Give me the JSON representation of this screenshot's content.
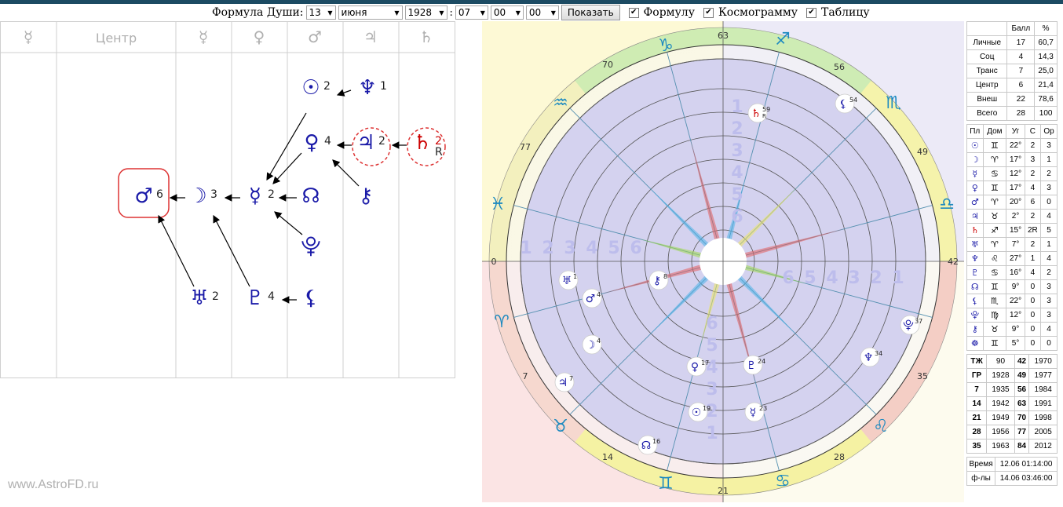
{
  "form": {
    "label": "Формула Души:",
    "day": "13",
    "month": "июня",
    "year": "1928",
    "hour": "07",
    "minute": "00",
    "second": "00",
    "separator": ":",
    "button": "Показать",
    "opt1": "Формулу",
    "opt2": "Космограмму",
    "opt3": "Таблицу",
    "check": "✔"
  },
  "grid_headers": [
    "☿",
    "Центр",
    "☿",
    "♀",
    "♂",
    "♃",
    "♄"
  ],
  "formula_nodes": [
    {
      "glyph": "☉",
      "num": "2",
      "color": "#1a1aa8"
    },
    {
      "glyph": "♆",
      "num": "1",
      "color": "#1a1aa8"
    },
    {
      "glyph": "♀",
      "num": "4",
      "color": "#1a1aa8"
    },
    {
      "glyph": "♃",
      "num": "2",
      "color": "#1a1aa8"
    },
    {
      "glyph": "♄",
      "num": "2",
      "sub": "R",
      "color": "#c00"
    },
    {
      "glyph": "♂",
      "num": "6",
      "color": "#1a1aa8"
    },
    {
      "glyph": "☽",
      "num": "3",
      "color": "#1a1aa8"
    },
    {
      "glyph": "☿",
      "num": "2",
      "color": "#1a1aa8"
    },
    {
      "glyph": "☊",
      "num": "",
      "color": "#1a1aa8"
    },
    {
      "glyph": "⚷",
      "num": "",
      "color": "#1a1aa8"
    },
    {
      "glyph": "⯓",
      "num": "",
      "color": "#1a1aa8"
    },
    {
      "glyph": "♅",
      "num": "2",
      "color": "#1a1aa8"
    },
    {
      "glyph": "♇",
      "num": "4",
      "color": "#1a1aa8"
    },
    {
      "glyph": "⚸",
      "num": "",
      "color": "#1a1aa8"
    }
  ],
  "footer": "www.AstroFD.ru",
  "chart": {
    "degree_labels": [
      "63",
      "56",
      "49",
      "42",
      "35",
      "28",
      "21",
      "14",
      "7",
      "0",
      "77",
      "70"
    ],
    "zodiac": [
      "♐",
      "♏",
      "♎",
      "♌",
      "♋",
      "♊",
      "♉",
      "♈",
      "♓",
      "♒",
      "♑"
    ],
    "ring_numbers_top": [
      "1",
      "2",
      "3",
      "4",
      "5",
      "6"
    ],
    "ring_numbers_left": [
      "1",
      "2",
      "3",
      "4",
      "5",
      "6"
    ],
    "ring_numbers_right": [
      "6",
      "5",
      "4",
      "3",
      "2",
      "1"
    ],
    "ring_numbers_bottom": [
      "6",
      "5",
      "4",
      "3",
      "2",
      "1"
    ],
    "planets": [
      {
        "glyph": "♄",
        "deg": "59",
        "sub": "R"
      },
      {
        "glyph": "⚸",
        "deg": "54"
      },
      {
        "glyph": "♅",
        "deg": "1"
      },
      {
        "glyph": "♂",
        "deg": "4"
      },
      {
        "glyph": "☽",
        "deg": "4"
      },
      {
        "glyph": "♃",
        "deg": "7"
      },
      {
        "glyph": "⚷",
        "deg": "8"
      },
      {
        "glyph": "♀",
        "deg": "17"
      },
      {
        "glyph": "♇",
        "deg": "24"
      },
      {
        "glyph": "☉",
        "deg": "19"
      },
      {
        "glyph": "☿",
        "deg": "23"
      },
      {
        "glyph": "☊",
        "deg": "16"
      },
      {
        "glyph": "♆",
        "deg": "34"
      },
      {
        "glyph": "⯓",
        "deg": "37"
      }
    ]
  },
  "score_table": {
    "headers": [
      "",
      "Балл",
      "%"
    ],
    "rows": [
      [
        "Личные",
        "17",
        "60,7"
      ],
      [
        "Соц",
        "4",
        "14,3"
      ],
      [
        "Транс",
        "7",
        "25,0"
      ],
      [
        "Центр",
        "6",
        "21,4"
      ],
      [
        "Внеш",
        "22",
        "78,6"
      ],
      [
        "Всего",
        "28",
        "100"
      ]
    ]
  },
  "planet_table": {
    "headers": [
      "Пл",
      "Дом",
      "Уг",
      "С",
      "Ор"
    ],
    "rows": [
      [
        "☉",
        "♊",
        "22°",
        "2",
        "3"
      ],
      [
        "☽",
        "♈",
        "17°",
        "3",
        "1"
      ],
      [
        "☿",
        "♋",
        "12°",
        "2",
        "2"
      ],
      [
        "♀",
        "♊",
        "17°",
        "4",
        "3"
      ],
      [
        "♂",
        "♈",
        "20°",
        "6",
        "0"
      ],
      [
        "♃",
        "♉",
        "2°",
        "2",
        "4"
      ],
      [
        "♄",
        "♐",
        "15°",
        "2R",
        "5"
      ],
      [
        "♅",
        "♈",
        "7°",
        "2",
        "1"
      ],
      [
        "♆",
        "♌",
        "27°",
        "1",
        "4"
      ],
      [
        "♇",
        "♋",
        "16°",
        "4",
        "2"
      ],
      [
        "☊",
        "♊",
        "9°",
        "0",
        "3"
      ],
      [
        "⚸",
        "♏",
        "22°",
        "0",
        "3"
      ],
      [
        "⯓",
        "♍",
        "12°",
        "0",
        "3"
      ],
      [
        "⚷",
        "♉",
        "9°",
        "0",
        "4"
      ],
      [
        "☸",
        "♊",
        "5°",
        "0",
        "0"
      ]
    ]
  },
  "years_table": {
    "rows": [
      [
        "ТЖ",
        "90",
        "42",
        "1970"
      ],
      [
        "ГР",
        "1928",
        "49",
        "1977"
      ],
      [
        "7",
        "1935",
        "56",
        "1984"
      ],
      [
        "14",
        "1942",
        "63",
        "1991"
      ],
      [
        "21",
        "1949",
        "70",
        "1998"
      ],
      [
        "28",
        "1956",
        "77",
        "2005"
      ],
      [
        "35",
        "1963",
        "84",
        "2012"
      ]
    ]
  },
  "time_table": {
    "rows": [
      [
        "Время",
        "12.06 01:14:00"
      ],
      [
        "ф-лы",
        "14.06 03:46:00"
      ]
    ]
  }
}
